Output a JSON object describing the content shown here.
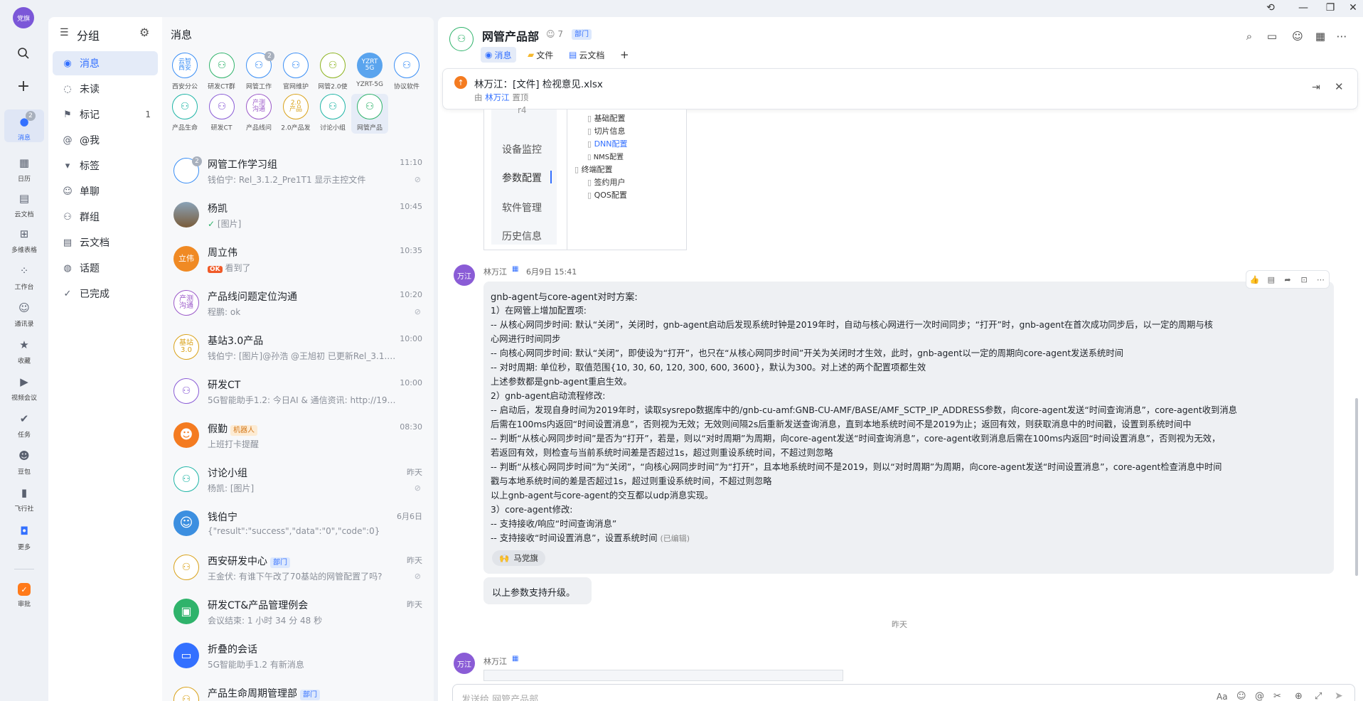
{
  "window": {
    "history_icon": "history-icon",
    "minimize": "—",
    "restore": "❐",
    "close": "✕"
  },
  "rail": {
    "logo": "党旗",
    "items": [
      {
        "label": "消息",
        "icon": "chat-icon",
        "badge": "2"
      },
      {
        "label": "日历",
        "icon": "calendar-icon"
      },
      {
        "label": "云文档",
        "icon": "doc-icon"
      },
      {
        "label": "多维表格",
        "icon": "table-icon"
      },
      {
        "label": "工作台",
        "icon": "apps-icon"
      },
      {
        "label": "通讯录",
        "icon": "contacts-icon"
      },
      {
        "label": "收藏",
        "icon": "star-icon"
      },
      {
        "label": "视频会议",
        "icon": "video-icon"
      },
      {
        "label": "任务",
        "icon": "task-icon"
      },
      {
        "label": "豆包",
        "icon": "doubao-icon"
      },
      {
        "label": "飞行社",
        "icon": "flight-icon"
      },
      {
        "label": "更多",
        "icon": "more-icon"
      },
      {
        "label": "审批",
        "icon": "approval-icon"
      }
    ]
  },
  "groups": {
    "title": "分组",
    "items": [
      {
        "label": "消息",
        "icon": "◉"
      },
      {
        "label": "未读",
        "icon": "◌"
      },
      {
        "label": "标记",
        "icon": "⚑",
        "count": "1"
      },
      {
        "label": "@我",
        "icon": "@"
      },
      {
        "label": "标签",
        "icon": "▾"
      },
      {
        "label": "单聊",
        "icon": "☺"
      },
      {
        "label": "群组",
        "icon": "⚇"
      },
      {
        "label": "云文档",
        "icon": "▤"
      },
      {
        "label": "话题",
        "icon": "◍"
      },
      {
        "label": "已完成",
        "icon": "✓"
      }
    ]
  },
  "convs": {
    "title": "消息",
    "pinned": [
      {
        "avatar": "云智\n西安",
        "label": "西安分公"
      },
      {
        "avatar": "⚇",
        "label": "研发CT群"
      },
      {
        "avatar": "⚇",
        "label": "网管工作",
        "badge": "2"
      },
      {
        "avatar": "⚇",
        "label": "官网维护"
      },
      {
        "avatar": "⚇",
        "label": "网管2.0使"
      },
      {
        "avatar": "YZRT\n5G",
        "label": "YZRT-5G"
      },
      {
        "avatar": "⚇",
        "label": "协议软件"
      },
      {
        "avatar": "⚇",
        "label": "产品生命"
      },
      {
        "avatar": "⚇",
        "label": "研发CT"
      },
      {
        "avatar": "产测\n沟通",
        "label": "产品线问"
      },
      {
        "avatar": "2.0\n产品",
        "label": "2.0产品发"
      },
      {
        "avatar": "⚇",
        "label": "讨论小组"
      },
      {
        "avatar": "⚇",
        "label": "网管产品"
      }
    ],
    "list": [
      {
        "name": "网管工作学习组",
        "time": "11:10",
        "preview": "钱伯宁: Rel_3.1.2_Pre1T1 显示主控文件",
        "avatar": "⚇",
        "badge": "2",
        "muted": true
      },
      {
        "name": "杨凯",
        "time": "10:45",
        "preview": "[图片]",
        "avatar": "",
        "status": "✓"
      },
      {
        "name": "周立伟",
        "time": "10:35",
        "preview": "看到了",
        "avatar": "立伟",
        "ok": "OK"
      },
      {
        "name": "产品线问题定位沟通",
        "time": "10:20",
        "preview": "程鹏: ok",
        "avatar": "产测\n沟通",
        "muted": true
      },
      {
        "name": "基站3.0产品",
        "time": "10:00",
        "preview": "钱伯宁: [图片]@孙浩 @王旭初 已更新Rel_3.1.2_Pre1T...",
        "avatar": "基站\n3.0"
      },
      {
        "name": "研发CT",
        "time": "10:00",
        "preview": "5G智能助手1.2: 今日AI & 通信资讯:   http://192.168.1...",
        "avatar": "⚇"
      },
      {
        "name": "假勤",
        "tag": "机器人",
        "time": "08:30",
        "preview": "上班打卡提醒",
        "avatar": "☻"
      },
      {
        "name": "讨论小组",
        "time": "昨天",
        "preview": "杨凯: [图片]",
        "avatar": "⚇",
        "muted": true
      },
      {
        "name": "钱伯宁",
        "time": "6月6日",
        "preview": "{\"result\":\"success\",\"data\":\"0\",\"code\":0}",
        "avatar": "☺"
      },
      {
        "name": "西安研发中心",
        "tag": "部门",
        "time": "昨天",
        "preview": "王金伏: 有谁下午改了70基站的网管配置了吗?",
        "avatar": "⚇",
        "muted": true
      },
      {
        "name": "研发CT&产品管理例会",
        "time": "昨天",
        "preview": "会议结束: 1 小时 34 分 48 秒",
        "avatar": "▣"
      },
      {
        "name": "折叠的会话",
        "time": "",
        "preview": "5G智能助手1.2 有新消息",
        "avatar": "▭"
      },
      {
        "name": "产品生命周期管理部",
        "tag": "部门",
        "time": "",
        "preview": "",
        "avatar": "⚇"
      }
    ]
  },
  "chat": {
    "title": "网管产品部",
    "members": "7",
    "dept_tag": "部门",
    "tabs": [
      "消息",
      "文件",
      "云文档"
    ],
    "add_tab": "+",
    "pinned_notice": {
      "title": "林万江：[文件] 检视意见.xlsx",
      "by_prefix": "由",
      "by_name": "林万江",
      "by_suffix": "置顶"
    },
    "screenshot": {
      "menu": [
        "设备监控",
        "参数配置",
        "软件管理",
        "历史信息"
      ],
      "menu_top": "r4",
      "tree": [
        "基础配置",
        "切片信息",
        "DNN配置",
        "NMS配置",
        "终端配置",
        "签约用户",
        "QOS配置"
      ]
    },
    "message": {
      "avatar": "万江",
      "sender": "林万江",
      "time": "6月9日 15:41",
      "lines": [
        "gnb-agent与core-agent对时方案:",
        "1）在网管上增加配置项:",
        "      -- 从核心网同步时间: 默认“关闭”，关闭时，gnb-agent启动后发现系统时钟是2019年时，自动与核心网进行一次时间同步；“打开”时，gnb-agent在首次成功同步后，以一定的周期与核",
        "心网进行时间同步",
        "      -- 向核心网同步时间: 默认“关闭”，即使设为“打开”，也只在“从核心网同步时间”开关为关闭时才生效，此时，gnb-agent以一定的周期向core-agent发送系统时间",
        "      -- 对时周期: 单位秒，取值范围{10, 30, 60, 120, 300, 600, 3600}，默认为300。对上述的两个配置项都生效",
        "    上述参数都是gnb-agent重启生效。",
        "2）gnb-agent启动流程修改:",
        "      -- 启动后，发现自身时间为2019年时，读取sysrepo数据库中的/gnb-cu-amf:GNB-CU-AMF/BASE/AMF_SCTP_IP_ADDRESS参数，向core-agent发送“时间查询消息”，core-agent收到消息",
        "后需在100ms内返回“时间设置消息”，否则视为无效；无效则间隔2s后重新发送查询消息，直到本地系统时间不是2019为止；返回有效，则获取消息中的时间戳，设置到系统时间中",
        "      -- 判断“从核心网同步时间”是否为“打开”，若是，则以“对时周期”为周期，向core-agent发送“时间查询消息”，core-agent收到消息后需在100ms内返回“时间设置消息”，否则视为无效，",
        "若返回有效，则检查与当前系统时间差是否超过1s，超过则重设系统时间，不超过则忽略",
        "      -- 判断“从核心网同步时间”为“关闭”，“向核心网同步时间”为“打开”，且本地系统时间不是2019，则以“对时周期”为周期，向core-agent发送“时间设置消息”，core-agent检查消息中时间",
        "戳与本地系统时间的差是否超过1s，超过则重设系统时间，不超过则忽略",
        "     以上gnb-agent与core-agent的交互都以udp消息实现。",
        "3）core-agent修改:",
        "     -- 支持接收/响应“时间查询消息”",
        "     -- 支持接收“时间设置消息”，设置系统时间"
      ],
      "edited": "(已编辑)",
      "reaction_icon": "🙌",
      "reaction_name": "马党旗",
      "followup": "以上参数支持升级。"
    },
    "date_divider": "昨天",
    "next_message": {
      "avatar": "万江",
      "sender": "林万江"
    },
    "input_placeholder": "发送给 网管产品部"
  }
}
